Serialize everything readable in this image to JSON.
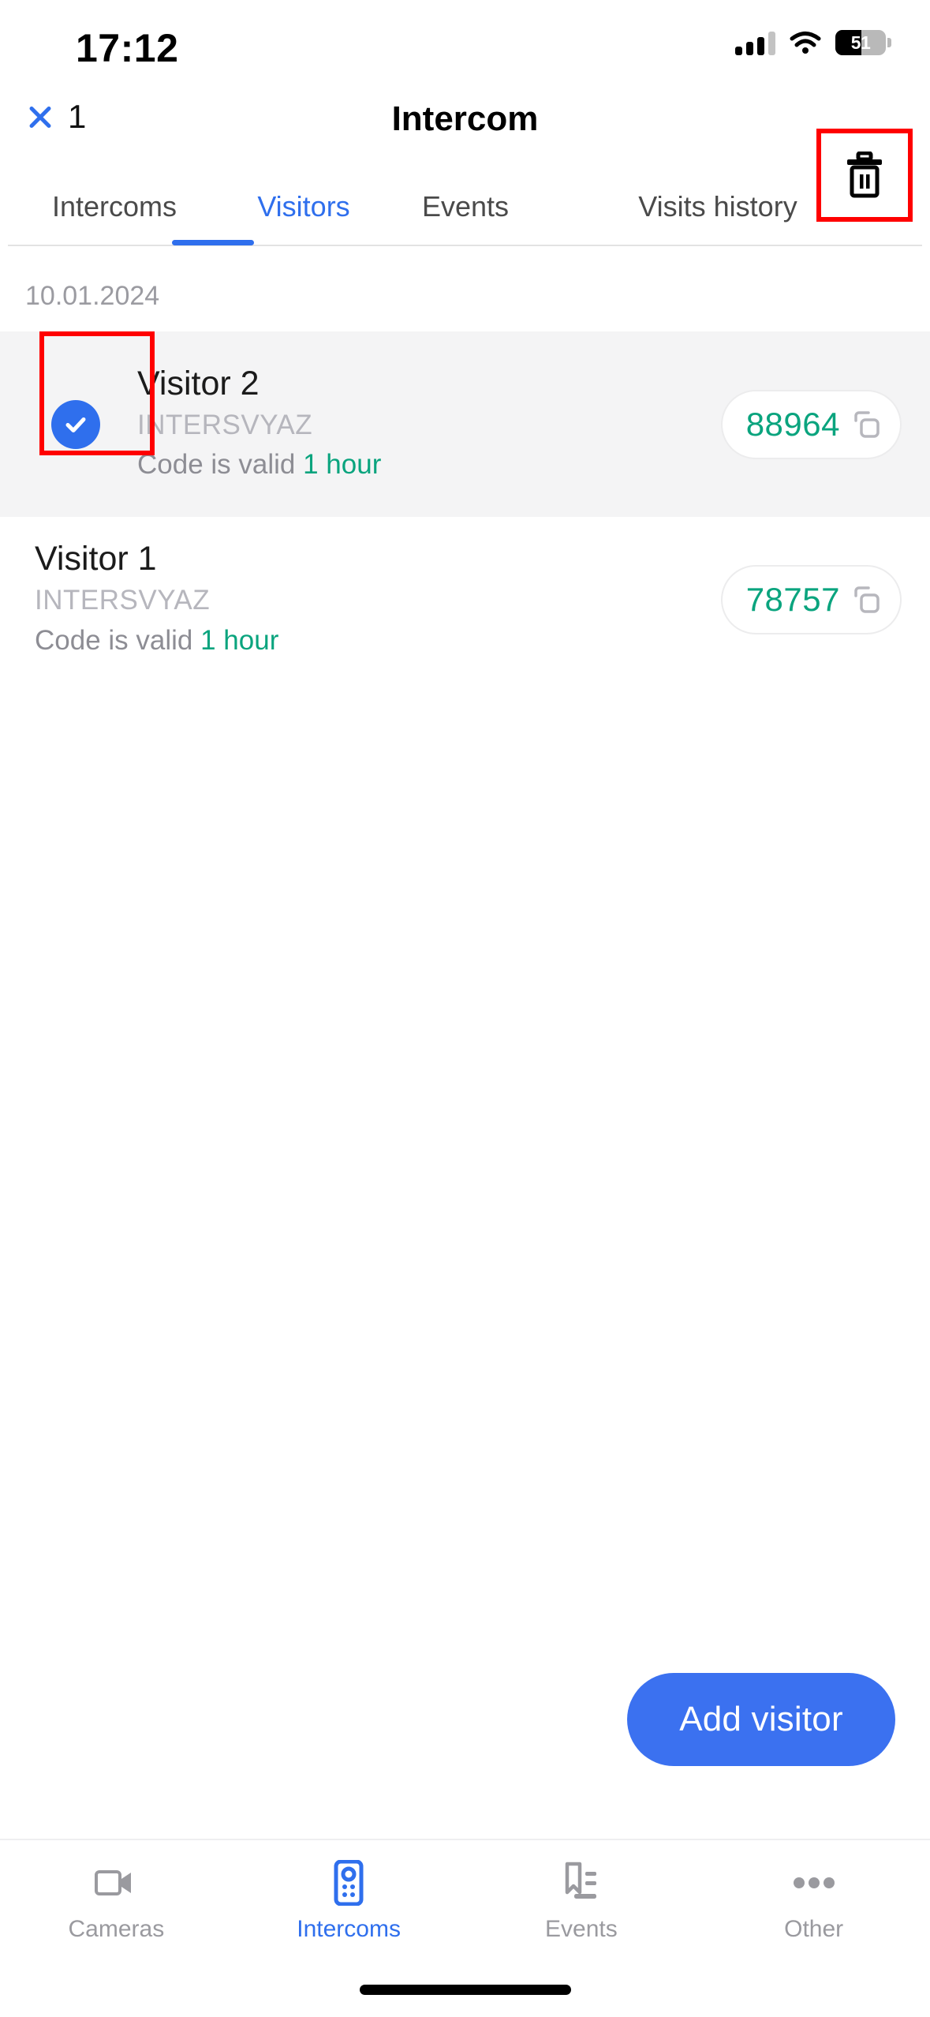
{
  "status_bar": {
    "time": "17:12",
    "battery_percent": "51",
    "battery_level": 51,
    "signal_icon": "cellular-signal-icon",
    "wifi_icon": "wifi-icon",
    "battery_icon": "battery-icon"
  },
  "header": {
    "close_icon": "close-x-icon",
    "selected_count": "1",
    "title": "Intercom",
    "delete_icon": "trash-icon",
    "highlight_color": "#ff0000"
  },
  "tabs": {
    "items": [
      {
        "label": "Intercoms",
        "active": false
      },
      {
        "label": "Visitors",
        "active": true
      },
      {
        "label": "Events",
        "active": false
      },
      {
        "label": "Visits history",
        "active": false
      }
    ],
    "active_color": "#2f6fed"
  },
  "list": {
    "date_header": "10.01.2024",
    "rows": [
      {
        "name": "Visitor 2",
        "org": "INTERSVYAZ",
        "valid_prefix": "Code is valid ",
        "valid_value": "1 hour",
        "code": "88964",
        "selected": true,
        "check_icon": "check-circle-icon",
        "copy_icon": "copy-icon"
      },
      {
        "name": "Visitor 1",
        "org": "INTERSVYAZ",
        "valid_prefix": "Code is valid ",
        "valid_value": "1 hour",
        "code": "78757",
        "selected": false,
        "check_icon": "check-circle-icon",
        "copy_icon": "copy-icon"
      }
    ],
    "code_color": "#0aa47e"
  },
  "fab": {
    "label": "Add visitor",
    "color": "#3b71f0"
  },
  "bottom_nav": {
    "items": [
      {
        "label": "Cameras",
        "icon": "video-camera-icon",
        "active": false
      },
      {
        "label": "Intercoms",
        "icon": "intercom-panel-icon",
        "active": true
      },
      {
        "label": "Events",
        "icon": "bookmark-list-icon",
        "active": false
      },
      {
        "label": "Other",
        "icon": "ellipsis-icon",
        "active": false
      }
    ],
    "active_color": "#2f6fed"
  }
}
